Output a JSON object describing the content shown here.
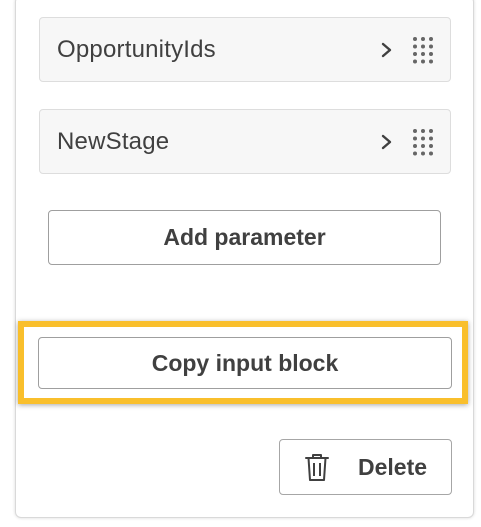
{
  "parameters": [
    {
      "name": "OpportunityIds"
    },
    {
      "name": "NewStage"
    }
  ],
  "actions": {
    "add_parameter_label": "Add parameter",
    "copy_input_block_label": "Copy input block",
    "delete_label": "Delete"
  },
  "icons": {
    "chevron": "chevron-right-icon",
    "drag": "drag-handle-icon",
    "delete": "trash-icon"
  },
  "colors": {
    "highlight": "#f9bf2c",
    "text": "#404040",
    "row_background": "#f7f7f7"
  }
}
